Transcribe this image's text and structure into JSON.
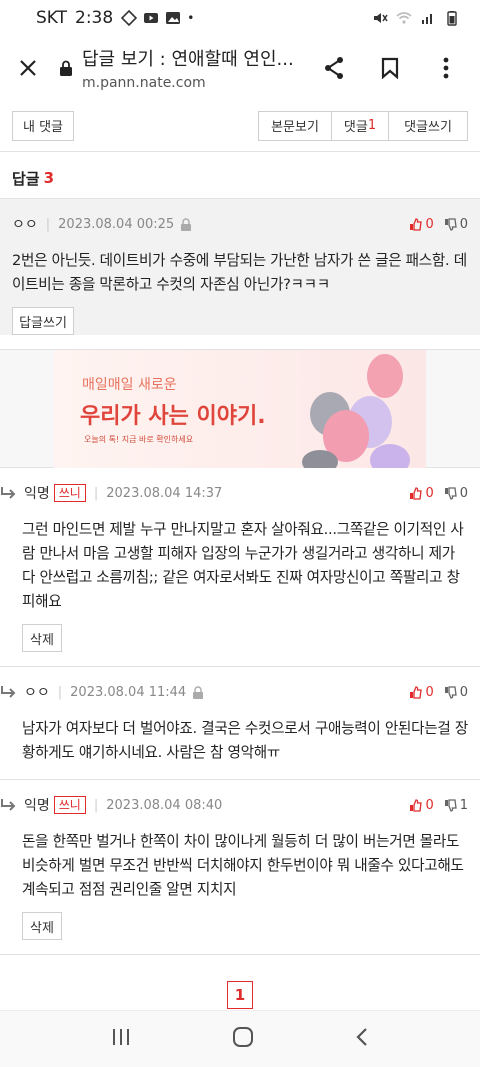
{
  "status_bar": {
    "carrier": "SKT",
    "time": "2:38",
    "dot": "•"
  },
  "url_bar": {
    "page_title": "답글 보기 : 연애할때 연인...",
    "url": "m.pann.nate.com"
  },
  "top_buttons": {
    "my_comments": "내 댓글",
    "view_original": "본문보기",
    "comments_label": "댓글",
    "comments_count": "1",
    "write_comment": "댓글쓰기"
  },
  "replies_header": {
    "label": "답글",
    "count": "3"
  },
  "parent_comment": {
    "nick": "ㅇㅇ",
    "date": "2023.08.04 00:25",
    "up": "0",
    "down": "0",
    "text": "2번은 아닌듯. 데이트비가 수중에 부담되는 가난한 남자가 쓴 글은 패스함. 데이트비는 종을 막론하고 수컷의 자존심 아닌가?ㅋㅋㅋ",
    "reply_button": "답글쓰기"
  },
  "ad": {
    "subtitle": "매일매일 새로운",
    "title": "우리가 사는 이야기.",
    "small": "오늘의 톡! 지금 바로 확인하세요"
  },
  "replies": [
    {
      "nick": "익명",
      "badge": "쓰니",
      "date": "2023.08.04 14:37",
      "up": "0",
      "down": "0",
      "text": "그런 마인드면 제발 누구 만나지말고 혼자 살아줘요...그쪽같은 이기적인 사람 만나서 마음 고생할 피해자 입장의 누군가가 생길거라고 생각하니 제가 다 안쓰럽고 소름끼침;; 같은 여자로서봐도 진짜 여자망신이고 쪽팔리고 창피해요",
      "button": "삭제"
    },
    {
      "nick": "ㅇㅇ",
      "badge": "",
      "date": "2023.08.04 11:44",
      "up": "0",
      "down": "0",
      "text": "남자가 여자보다 더 벌어야죠. 결국은 수컷으로서 구애능력이 안된다는걸 장황하게도 얘기하시네요. 사람은 참 영악해ㅠ",
      "button": ""
    },
    {
      "nick": "익명",
      "badge": "쓰니",
      "date": "2023.08.04 08:40",
      "up": "0",
      "down": "1",
      "text": "돈을 한쪽만 벌거나 한쪽이 차이 많이나게 월등히 더 많이 버는거면 몰라도 비슷하게 벌면 무조건 반반씩 더치해야지 한두번이야 뭐 내줄수 있다고해도 계속되고 점점 권리인줄 알면 지치지",
      "button": "삭제"
    }
  ],
  "pagination": {
    "current": "1"
  },
  "colors": {
    "accent_red": "#e02b2b",
    "border": "#e2e2e2",
    "gray_bg": "#f2f2f2"
  }
}
